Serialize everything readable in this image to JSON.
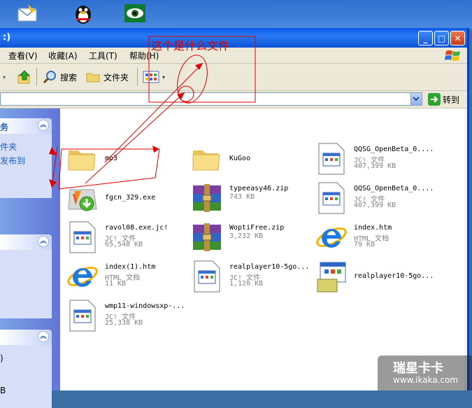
{
  "window": {
    "title": ":)",
    "minimize": "_",
    "maximize": "□",
    "close": "✕"
  },
  "menu": {
    "view": "查看(V)",
    "favorites": "收藏(A)",
    "tools": "工具(T)",
    "help": "帮助(H)"
  },
  "toolbar": {
    "search": "搜索",
    "folders": "文件夹"
  },
  "address": {
    "go": "转到"
  },
  "left_panel": {
    "panel1_title": "务",
    "panel1_links": [
      "件夹",
      "发布到"
    ],
    "panel3_lines": [
      ")",
      "B"
    ]
  },
  "files": [
    {
      "name": "mp3",
      "lines": [],
      "icon": "folder-icon"
    },
    {
      "name": "KuGoo",
      "lines": [],
      "icon": "folder-icon"
    },
    {
      "name": "QQSG_OpenBeta_0....",
      "lines": [
        "JC! 文件",
        "407,399 KB"
      ],
      "icon": "jc-file-icon"
    },
    {
      "name": "fgcn_329.exe",
      "lines": [],
      "icon": "installer-icon"
    },
    {
      "name": "typeeasy46.zip",
      "lines": [
        "743 KB"
      ],
      "icon": "winrar-icon"
    },
    {
      "name": "QQSG_OpenBeta_0....",
      "lines": [
        "JC! 文件",
        "407,399 KB"
      ],
      "icon": "jc-file-icon"
    },
    {
      "name": "ravol08.exe.jc!",
      "lines": [
        "JC! 文件",
        "65,548 KB"
      ],
      "icon": "jc-file-icon"
    },
    {
      "name": "WoptiFree.zip",
      "lines": [
        "3,232 KB"
      ],
      "icon": "winrar-icon"
    },
    {
      "name": "index.htm",
      "lines": [
        "HTML 文档",
        "79 KB"
      ],
      "icon": "ie-icon"
    },
    {
      "name": "index(1).htm",
      "lines": [
        "HTML 文档",
        "11 KB"
      ],
      "icon": "ie-icon"
    },
    {
      "name": "realplayer10-5go...",
      "lines": [
        "JC! 文件",
        "1,120 KB"
      ],
      "icon": "jc-file-icon"
    },
    {
      "name": "realplayer10-5go...",
      "lines": [],
      "icon": "setup-icon"
    },
    {
      "name": "wmp11-windowsxp-...",
      "lines": [
        "JC! 文件",
        "25,338 KB"
      ],
      "icon": "jc-file-icon"
    }
  ],
  "annotation": {
    "text": "这个是什么文件"
  },
  "watermark": {
    "brand": "瑞星卡卡",
    "url": "www.ikaka.com"
  },
  "colors": {
    "annotation": "#e00000",
    "title_bar": "#0a58e8",
    "task_pane": "#6f8fe0",
    "link": "#215dc6"
  }
}
